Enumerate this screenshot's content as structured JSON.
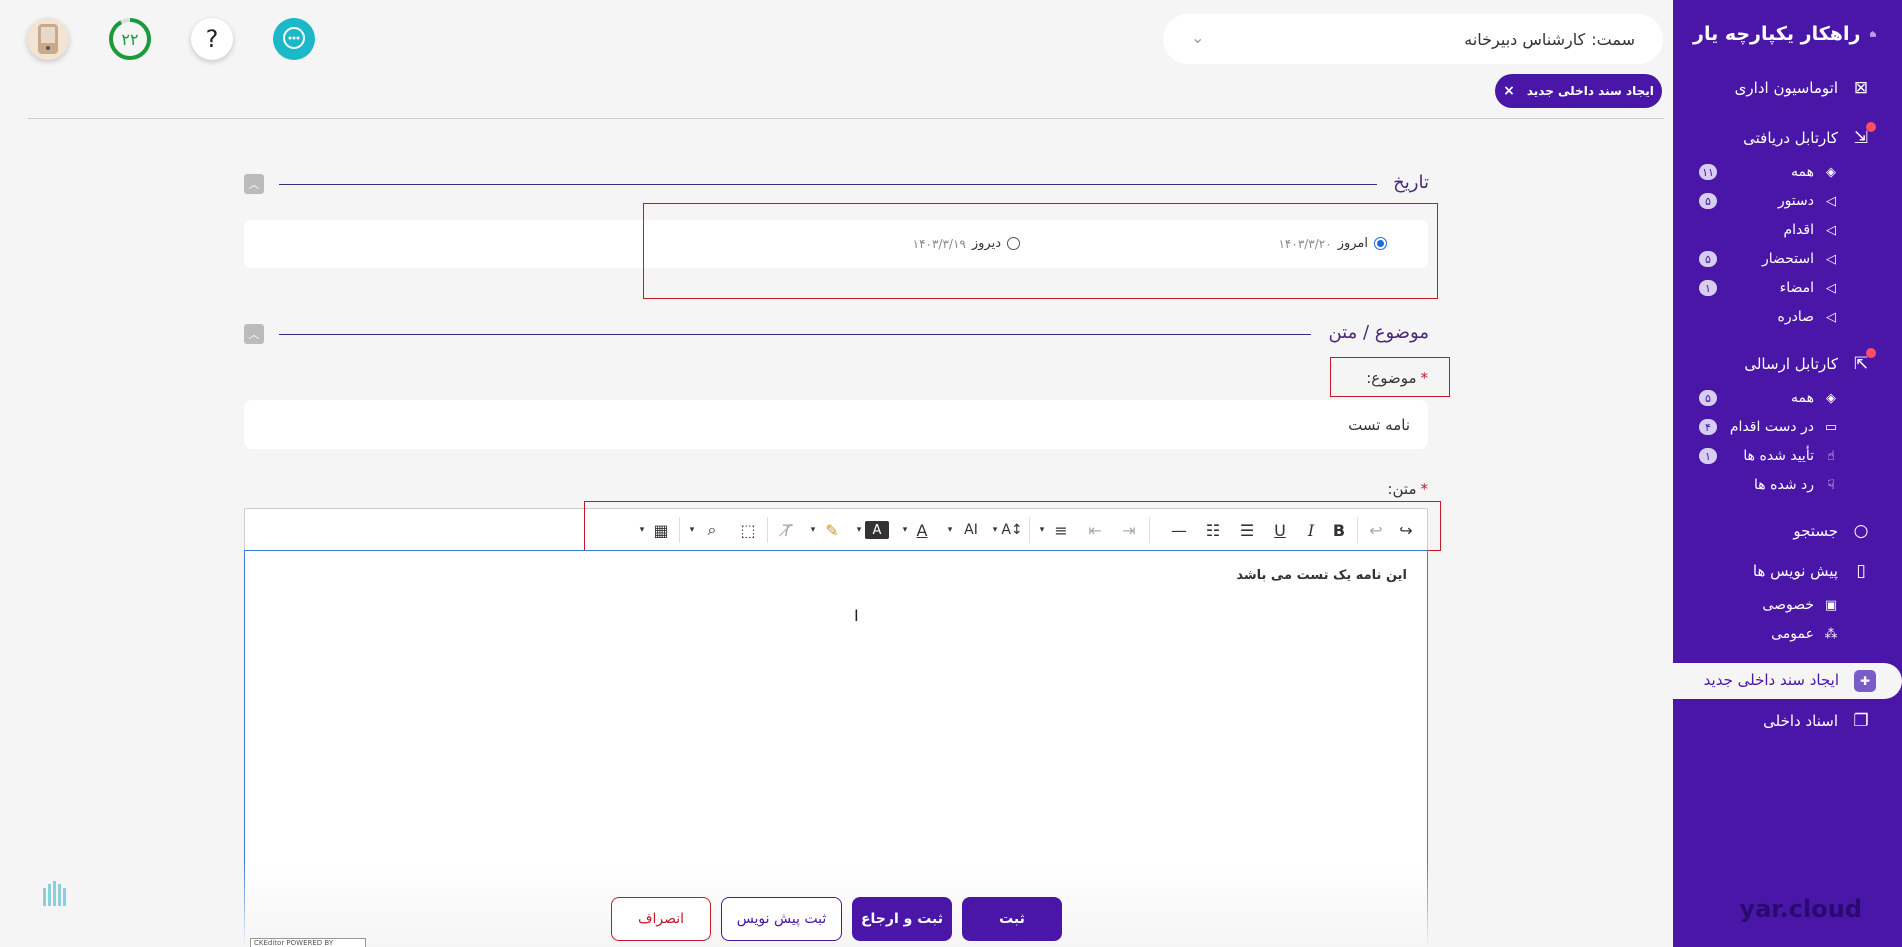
{
  "sidebar": {
    "title": "راهکار یکپارچه یار",
    "footer": "yar.cloud",
    "items": [
      {
        "label": "اتوماسیون اداری",
        "icon": "close-square-icon"
      },
      {
        "label": "کارتابل دریافتی",
        "icon": "inbox-download-icon"
      },
      {
        "label": "کارتابل ارسالی",
        "icon": "outbox-upload-icon"
      },
      {
        "label": "جستجو",
        "icon": "search-icon"
      },
      {
        "label": "پیش نویس ها",
        "icon": "book-icon"
      },
      {
        "label": "ایجاد سند داخلی جدید",
        "icon": "new-doc-icon"
      },
      {
        "label": "اسناد داخلی",
        "icon": "docs-icon"
      }
    ],
    "received": [
      {
        "label": "همه",
        "count": "۱۱",
        "icon": "layers-icon"
      },
      {
        "label": "دستور",
        "count": "۵",
        "icon": "triangle-left-icon"
      },
      {
        "label": "اقدام",
        "count": "",
        "icon": "triangle-left-icon"
      },
      {
        "label": "استحضار",
        "count": "۵",
        "icon": "triangle-left-icon"
      },
      {
        "label": "امضاء",
        "count": "۱",
        "icon": "triangle-left-icon"
      },
      {
        "label": "صادره",
        "count": "",
        "icon": "triangle-left-icon"
      }
    ],
    "sent": [
      {
        "label": "همه",
        "count": "۵",
        "icon": "layers-icon"
      },
      {
        "label": "در دست اقدام",
        "count": "۴",
        "icon": "open-book-icon"
      },
      {
        "label": "تأیید شده ها",
        "count": "۱",
        "icon": "thumbs-up-icon"
      },
      {
        "label": "رد شده ها",
        "count": "",
        "icon": "thumbs-down-icon"
      }
    ],
    "drafts": [
      {
        "label": "خصوصی",
        "icon": "lock-icon"
      },
      {
        "label": "عمومی",
        "icon": "group-icon"
      }
    ]
  },
  "header": {
    "role_prefix": "سمت:",
    "role_value": "کارشناس دبیرخانه",
    "progress_count": "۲۲",
    "help_symbol": "?",
    "tab_label": "ایجاد سند داخلی جدید",
    "tab_close": "×"
  },
  "date_section": {
    "title": "تاریخ",
    "options": [
      {
        "label": "امروز",
        "date": "۱۴۰۳/۳/۲۰",
        "selected": true
      },
      {
        "label": "دیروز",
        "date": "۱۴۰۳/۳/۱۹",
        "selected": false
      }
    ]
  },
  "subject_section": {
    "title": "موضوع / متن",
    "subject_label": "موضوع:",
    "subject_value": "نامه تست",
    "body_label": "متن:",
    "body_text": "این نامه یک تست می باشد",
    "required_mark": "*"
  },
  "buttons": {
    "submit": "ثبت",
    "submit_return": "ثبت و ارجاع",
    "save_draft": "ثبت پیش نویس",
    "cancel": "انصراف"
  },
  "editor_badge": "CKEditor POWERED BY",
  "colors": {
    "primary": "#4a16a8",
    "accent_teal": "#1bb8c9",
    "progress_green": "#1a9a3a",
    "required_red": "#c21a2a"
  }
}
